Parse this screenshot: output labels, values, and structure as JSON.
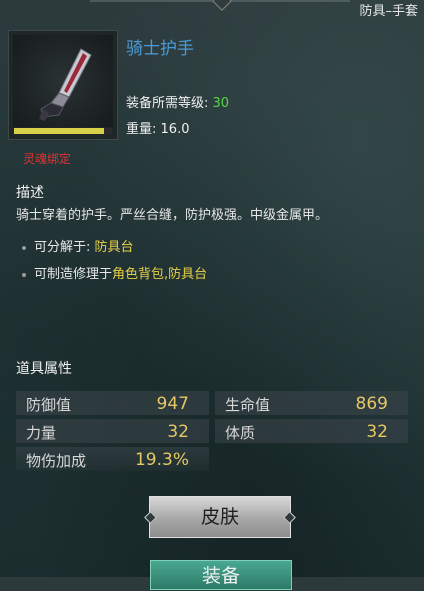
{
  "header": {
    "category": "防具–手套"
  },
  "item": {
    "name": "骑士护手",
    "icon": "gauntlet-icon",
    "bind_label": "灵魂绑定",
    "level_label": "装备所需等级:",
    "level_value": "30",
    "weight_label": "重量:",
    "weight_value": "16.0",
    "durability_fraction": 0.92
  },
  "description": {
    "title": "描述",
    "text": "骑士穿着的护手。严丝合缝，防护极强。中级金属甲。",
    "bullets": [
      {
        "prefix": "可分解于:",
        "value": "防具台"
      },
      {
        "prefix": "可制造修理于",
        "value": "角色背包,防具台"
      }
    ]
  },
  "attributes": {
    "title": "道具属性",
    "items": [
      {
        "label": "防御值",
        "value": "947"
      },
      {
        "label": "生命值",
        "value": "869"
      },
      {
        "label": "力量",
        "value": "32"
      },
      {
        "label": "体质",
        "value": "32"
      },
      {
        "label": "物伤加成",
        "value": "19.3%"
      }
    ]
  },
  "buttons": {
    "skin": "皮肤",
    "equip": "装备"
  },
  "colors": {
    "item_name": "#4a9bd8",
    "bind": "#e03434",
    "level_value": "#5bd34a",
    "highlight": "#e7d14a",
    "attr_value": "#e6c766",
    "equip_button": "#3a9582"
  }
}
